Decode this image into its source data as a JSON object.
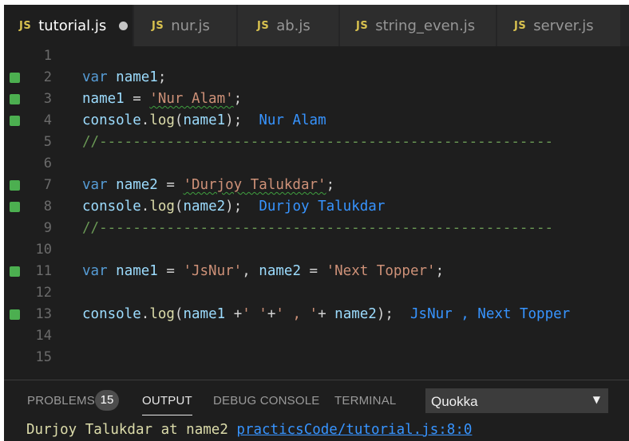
{
  "tabs": [
    {
      "icon": "JS",
      "label": "tutorial.js",
      "active": true,
      "modified": true
    },
    {
      "icon": "JS",
      "label": "nur.js"
    },
    {
      "icon": "JS",
      "label": "ab.js"
    },
    {
      "icon": "JS",
      "label": "string_even.js"
    },
    {
      "icon": "JS",
      "label": "server.js"
    }
  ],
  "editor": {
    "lines": [
      {
        "n": "1"
      },
      {
        "n": "2",
        "tok": {
          "a": "var",
          "b": "name1",
          "c": ";"
        }
      },
      {
        "n": "3",
        "tok": {
          "a": "name1",
          "b": " = ",
          "c": "'Nur Alam'",
          "d": ";"
        }
      },
      {
        "n": "4",
        "tok": {
          "a": "console",
          "b": ".",
          "c": "log",
          "d": "(",
          "e": "name1",
          "f": ");",
          "g": "Nur Alam"
        }
      },
      {
        "n": "5",
        "tok": {
          "a": "//------------------------------------------------------"
        }
      },
      {
        "n": "6"
      },
      {
        "n": "7",
        "tok": {
          "a": "var",
          "b": "name2",
          "c": " = ",
          "d": "'Durjoy Talukdar'",
          "e": ";"
        }
      },
      {
        "n": "8",
        "tok": {
          "a": "console",
          "b": ".",
          "c": "log",
          "d": "(",
          "e": "name2",
          "f": ");",
          "g": "Durjoy Talukdar"
        }
      },
      {
        "n": "9",
        "tok": {
          "a": "//------------------------------------------------------"
        }
      },
      {
        "n": "10"
      },
      {
        "n": "11",
        "tok": {
          "a": "var",
          "b": "name1",
          "c": " = ",
          "d": "'JsNur'",
          "e": ", ",
          "f": "name2",
          "g": " = ",
          "h": "'Next Topper'",
          "i": ";"
        }
      },
      {
        "n": "12"
      },
      {
        "n": "13",
        "tok": {
          "a": "console",
          "b": ".",
          "c": "log",
          "d": "(",
          "e": "name1",
          "f": " +",
          "g": "' '",
          "h": "+",
          "i": "' , '",
          "j": "+ ",
          "k": "name2",
          "l": ");",
          "m": "JsNur , Next Topper"
        }
      },
      {
        "n": "14"
      },
      {
        "n": "15"
      }
    ]
  },
  "panel": {
    "tabs": {
      "problems": "PROBLEMS",
      "output": "OUTPUT",
      "debug": "DEBUG CONSOLE",
      "terminal": "TERMINAL"
    },
    "problems_count": "15",
    "output_channel": "Quokka",
    "output_line": {
      "message": "Durjoy Talukdar at name2 ",
      "link": "practicsCode/tutorial.js:8:0"
    }
  },
  "colors": {
    "accent_link": "#3794ff",
    "coverage_marker": "#4caf50",
    "js_icon": "#d9c24f"
  }
}
